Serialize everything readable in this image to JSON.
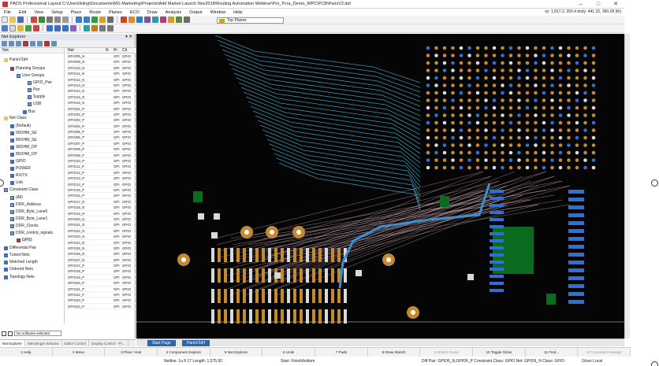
{
  "window": {
    "title": "PADS Professional Layout C:\\Users\\kling\\Documents\\MG Marketing\\Projects\\Add Market Launch Nov2018\\Routing Automation Webinar\\Pro_Pcra_Demo_WPC\\PCB\\ParisV2.dsf"
  },
  "menu": [
    "File",
    "Edit",
    "View",
    "Setup",
    "Place",
    "Route",
    "Planes",
    "ECO",
    "Draw",
    "Analysis",
    "Output",
    "Window",
    "Help"
  ],
  "coords": "xy: 1,817.2, 250.4   dxdy: 441.32, 360.28  (th)",
  "toolbar": {
    "combo_value": "Top Planes"
  },
  "explorer": {
    "title": "Net Explorer",
    "tree_header": "Net",
    "tree": [
      {
        "label": "ParisV2d4",
        "icon": "board-icon",
        "indent": 0
      },
      {
        "label": "Planning Groups",
        "icon": "planning-icon",
        "indent": 1
      },
      {
        "label": "User Groups",
        "icon": "group-icon",
        "indent": 2
      },
      {
        "label": "GPIO_Pwr",
        "icon": "group-icon",
        "indent": 3
      },
      {
        "label": "Pwr",
        "icon": "group-icon",
        "indent": 3
      },
      {
        "label": "Supply",
        "icon": "group-icon",
        "indent": 3
      },
      {
        "label": "USB",
        "icon": "group-icon",
        "indent": 3
      },
      {
        "label": "Bus",
        "icon": "bus-icon",
        "indent": 2
      },
      {
        "label": "Net Class",
        "icon": "folder-icon",
        "indent": 0
      },
      {
        "label": "(Default)",
        "icon": "net-icon",
        "indent": 1
      },
      {
        "label": "90OHM_SE",
        "icon": "net-icon",
        "indent": 1
      },
      {
        "label": "85OHM_SE",
        "icon": "net-icon",
        "indent": 1
      },
      {
        "label": "90OHM_DP",
        "icon": "net-icon",
        "indent": 1
      },
      {
        "label": "85OHM_DP",
        "icon": "net-icon",
        "indent": 1
      },
      {
        "label": "GPIO",
        "icon": "net-icon",
        "indent": 1
      },
      {
        "label": "POWER",
        "icon": "net-icon",
        "indent": 1
      },
      {
        "label": "RX/TX",
        "icon": "net-icon",
        "indent": 1
      },
      {
        "label": "Usb",
        "icon": "net-icon",
        "indent": 1
      },
      {
        "label": "Constraint Class",
        "icon": "constraint-icon",
        "indent": 0
      },
      {
        "label": "(All)",
        "icon": "constraint-icon",
        "indent": 1
      },
      {
        "label": "DDR_Address",
        "icon": "constraint-icon",
        "indent": 1
      },
      {
        "label": "DDR_Byte_Lane0",
        "icon": "constraint-icon",
        "indent": 1
      },
      {
        "label": "DDR_Byte_Lane1",
        "icon": "constraint-icon",
        "indent": 1
      },
      {
        "label": "DDR_Clocks",
        "icon": "constraint-icon",
        "indent": 1
      },
      {
        "label": "DDR_control_signals",
        "icon": "constraint-icon",
        "indent": 1
      },
      {
        "label": "GPIO",
        "icon": "constraint-icon",
        "indent": 1
      },
      {
        "label": "Differential Pair",
        "icon": "diffpair-icon",
        "indent": 0
      },
      {
        "label": "Tuned Nets",
        "icon": "tuned-icon",
        "indent": 0
      },
      {
        "label": "Matched Length",
        "icon": "matched-icon",
        "indent": 0
      },
      {
        "label": "Ordered Nets",
        "icon": "ordered-icon",
        "indent": 0
      },
      {
        "label": "Topology Nets",
        "icon": "topology-icon",
        "indent": 0
      }
    ],
    "table_headers": [
      "Net",
      "N",
      "Pr",
      "Ch"
    ],
    "table_rows": [
      [
        "GPIO09_N",
        "",
        "GPI",
        "GPIO"
      ],
      [
        "GPIO09_N",
        "",
        "GPI",
        "GPIO"
      ],
      [
        "GPIO10_N",
        "",
        "GPI",
        "GPIO"
      ],
      [
        "GPIO11_N",
        "",
        "GPI",
        "GPIO"
      ],
      [
        "GPIO12_N",
        "",
        "GPI",
        "GPIO"
      ],
      [
        "GPIO13_N",
        "",
        "GPI",
        "GPIO"
      ],
      [
        "GPIO14_N",
        "",
        "GPI",
        "GPIO"
      ],
      [
        "GPIO15_N",
        "",
        "GPI",
        "GPIO"
      ],
      [
        "GPIO16_N",
        "",
        "GPI",
        "GPIO"
      ],
      [
        "GPIO01_P",
        "",
        "GPI",
        "GPIO"
      ],
      [
        "GPIO02_P",
        "",
        "GPI",
        "GPIO"
      ],
      [
        "GPIO03_P",
        "",
        "GPI",
        "GPIO"
      ],
      [
        "GPIO04_P",
        "",
        "GPI",
        "GPIO"
      ],
      [
        "GPIO05_P",
        "",
        "GPI",
        "GPIO"
      ],
      [
        "GPIO06_P",
        "",
        "GPI",
        "GPIO"
      ],
      [
        "GPIO07_P",
        "",
        "GPI",
        "GPIO"
      ],
      [
        "GPIO08_P",
        "",
        "GPI",
        "GPIO"
      ],
      [
        "GPIO09_P",
        "",
        "GPI",
        "GPIO"
      ],
      [
        "GPIO10_P",
        "",
        "GPI",
        "GPIO"
      ],
      [
        "GPIO11_P",
        "",
        "GPI",
        "GPIO"
      ],
      [
        "GPIO12_P",
        "",
        "GPI",
        "GPIO"
      ],
      [
        "GPIO13_P",
        "",
        "GPI",
        "GPIO"
      ],
      [
        "GPIO14_P",
        "",
        "GPI",
        "GPIO"
      ],
      [
        "GPIO15_P",
        "",
        "GPI",
        "GPIO"
      ],
      [
        "GPIO16_P",
        "",
        "GPI",
        "GPIO"
      ],
      [
        "GPIO17_N",
        "",
        "GPI",
        "GPIO"
      ],
      [
        "GPIO18_N",
        "",
        "GPI",
        "GPIO"
      ],
      [
        "GPIO19_N",
        "",
        "GPI",
        "GPIO"
      ],
      [
        "GPIO20_N",
        "",
        "GPI",
        "GPIO"
      ],
      [
        "GPIO21_N",
        "",
        "GPI",
        "GPIO"
      ],
      [
        "GPIO22_N",
        "",
        "GPI",
        "GPIO"
      ],
      [
        "GPIO23_N",
        "",
        "GPI",
        "GPIO"
      ],
      [
        "GPIO24_N",
        "",
        "GPI",
        "GPIO"
      ],
      [
        "GPIO25_N",
        "",
        "GPI",
        "GPIO"
      ],
      [
        "GPIO26_N",
        "",
        "GPI",
        "GPIO"
      ],
      [
        "GPIO27_N",
        "",
        "GPI",
        "GPIO"
      ],
      [
        "GPIO17_P",
        "",
        "GPI",
        "GPIO"
      ],
      [
        "GPIO18_P",
        "",
        "GPI",
        "GPIO"
      ],
      [
        "GPIO19_P",
        "",
        "GPI",
        "GPIO"
      ],
      [
        "GPIO20_P",
        "",
        "GPI",
        "GPIO"
      ],
      [
        "GPIO21_P",
        "",
        "GPI",
        "GPIO"
      ],
      [
        "GPIO22_P",
        "",
        "GPI",
        "GPIO"
      ],
      [
        "GPIO23_P",
        "",
        "GPI",
        "GPIO"
      ],
      [
        "GPIO24_P",
        "",
        "GPI",
        "GPIO"
      ]
    ],
    "filter_label": "No software selected",
    "bottom_tabs": [
      "Net Explorer",
      "Messenger Window",
      "Editor Control",
      "Display Control - Pr..."
    ]
  },
  "page_tabs": [
    "Start Page",
    "ParisV2d4"
  ],
  "fkeys": [
    {
      "label": "1 Help",
      "enabled": true
    },
    {
      "label": "2 Move",
      "enabled": true
    },
    {
      "label": "3 Plow / Hub",
      "enabled": true
    },
    {
      "label": "4 Component Explore",
      "enabled": true
    },
    {
      "label": "5 Net Explorer",
      "enabled": true
    },
    {
      "label": "6 Units",
      "enabled": true
    },
    {
      "label": "7 Pads",
      "enabled": true
    },
    {
      "label": "8 Draw Sketch",
      "enabled": true
    },
    {
      "label": "9 Sketch Route",
      "enabled": false
    },
    {
      "label": "10 Toggle Gloss",
      "enabled": true
    },
    {
      "label": "11 Find...",
      "enabled": true
    },
    {
      "label": "12 Constraint Manage",
      "enabled": false
    }
  ],
  "status": {
    "nets": "Netline: 1u ft  17  Length: 1,575.92",
    "start": "Start: Finish/bottom",
    "diff": "Diff Pair: GPIO6_N,GPIO6_P  Constraint Class: GPIO  Net: GPIO6_N  Class: GPIO",
    "gloss": "Gloss Local"
  },
  "colors": {
    "canvas_bg": "#050505",
    "trace_cyan": "#41a9c9",
    "pad_orange": "#c48a32",
    "pad_blue": "#2f6fd6",
    "via_white": "#d9d9d9",
    "ratsnest": "#cfa9b6",
    "plane_green": "#0b6b1f"
  }
}
